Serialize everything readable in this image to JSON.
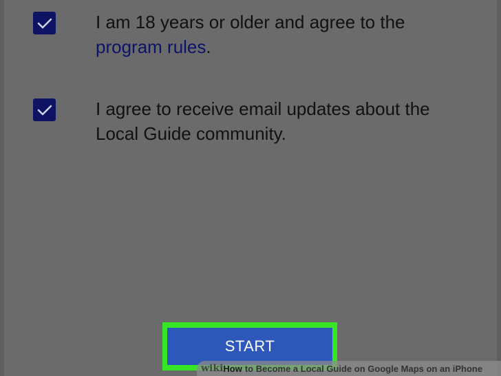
{
  "checkboxes": [
    {
      "checked": true,
      "text_before_link": "I am 18 years or older and agree to the",
      "link_text": "program rules",
      "text_after_link": "."
    },
    {
      "checked": true,
      "line_1": "I agree to receive email updates about the",
      "line_2": "Local Guide community."
    }
  ],
  "start_button": {
    "label": "START"
  },
  "watermark": {
    "brand": "wiki",
    "how": "How",
    "title": "to Become a Local Guide on Google Maps on an iPhone"
  },
  "colors": {
    "background": "#6b6b6b",
    "checkbox": "#0e1363",
    "link": "#0d1468",
    "button": "#2d57b9",
    "highlight": "#36e624"
  }
}
